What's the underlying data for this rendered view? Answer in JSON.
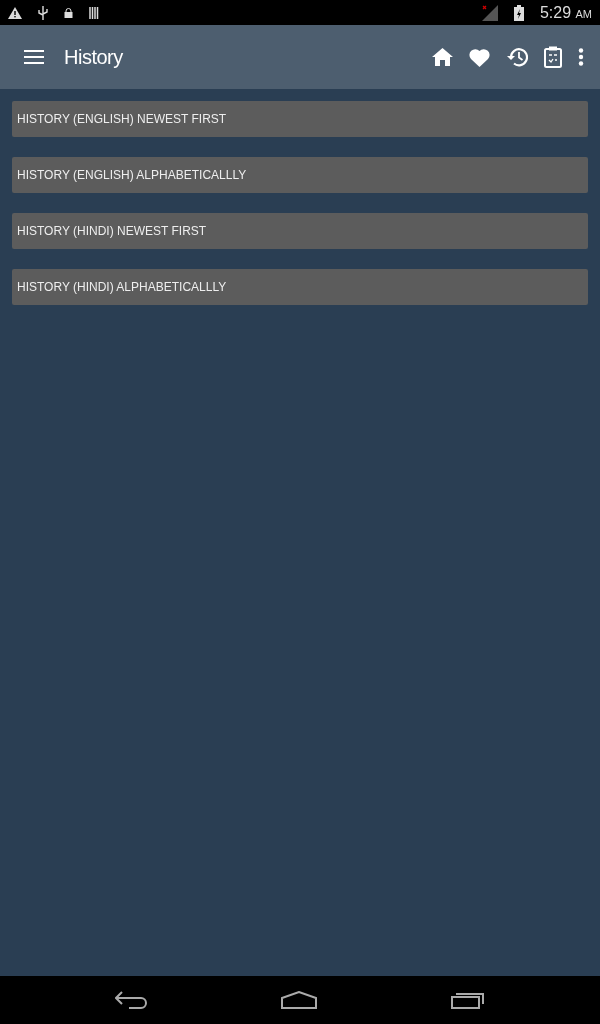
{
  "status_bar": {
    "time": "5:29",
    "meridiem": "AM"
  },
  "app_bar": {
    "title": "History"
  },
  "buttons": [
    {
      "label": "HISTORY (ENGLISH) NEWEST FIRST"
    },
    {
      "label": "HISTORY (ENGLISH) ALPHABETICALLLY"
    },
    {
      "label": "HISTORY (HINDI) NEWEST FIRST"
    },
    {
      "label": "HISTORY (HINDI) ALPHABETICALLLY"
    }
  ]
}
